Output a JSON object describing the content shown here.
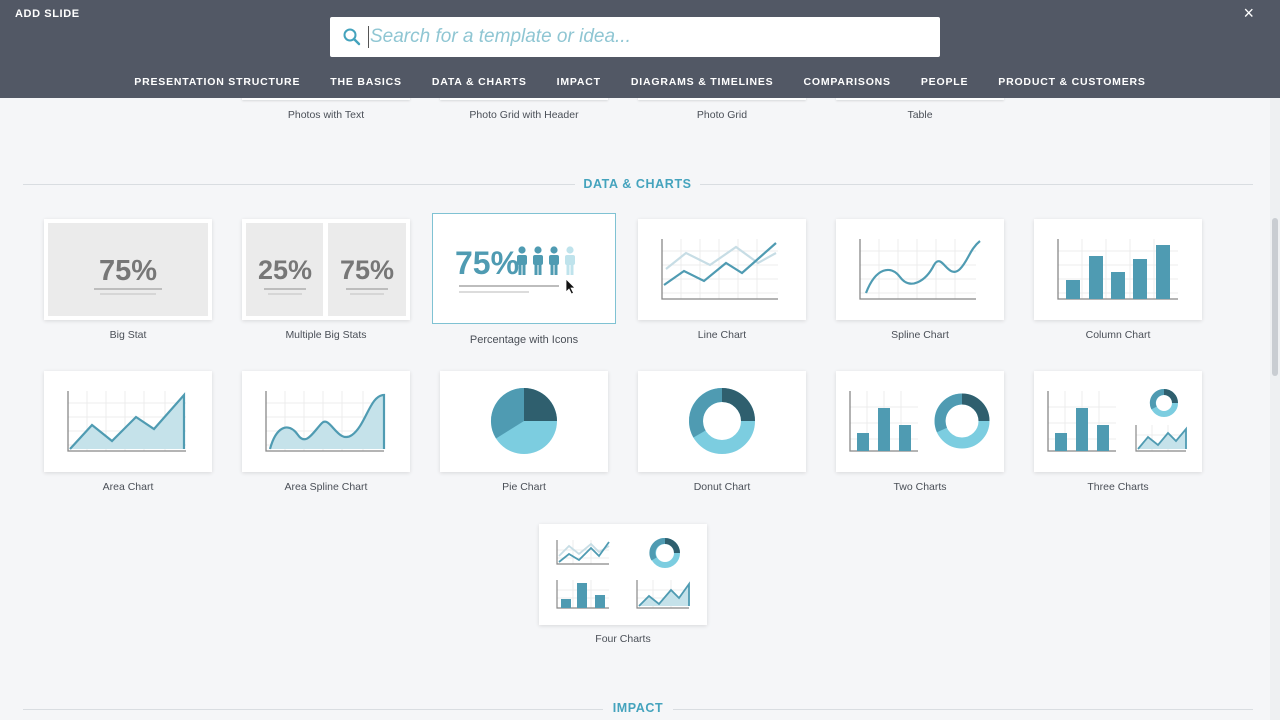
{
  "header": {
    "title": "ADD SLIDE",
    "close_label": "×"
  },
  "search": {
    "placeholder": "Search for a template or idea..."
  },
  "tabs": [
    "PRESENTATION STRUCTURE",
    "THE BASICS",
    "DATA & CHARTS",
    "IMPACT",
    "DIAGRAMS & TIMELINES",
    "COMPARISONS",
    "PEOPLE",
    "PRODUCT & CUSTOMERS"
  ],
  "top_row": [
    "Photos with Text",
    "Photo Grid with Header",
    "Photo Grid",
    "Table"
  ],
  "sections": {
    "data_charts": "DATA & CHARTS",
    "impact": "IMPACT"
  },
  "templates": {
    "big_stat": {
      "label": "Big Stat",
      "value": "75%"
    },
    "multiple_big_stats": {
      "label": "Multiple Big Stats",
      "value_a": "25%",
      "value_b": "75%"
    },
    "percentage_icons": {
      "label": "Percentage with Icons",
      "value": "75%"
    },
    "line_chart": {
      "label": "Line Chart"
    },
    "spline_chart": {
      "label": "Spline Chart"
    },
    "column_chart": {
      "label": "Column Chart"
    },
    "area_chart": {
      "label": "Area Chart"
    },
    "area_spline_chart": {
      "label": "Area Spline Chart"
    },
    "pie_chart": {
      "label": "Pie Chart"
    },
    "donut_chart": {
      "label": "Donut Chart"
    },
    "two_charts": {
      "label": "Two Charts"
    },
    "three_charts": {
      "label": "Three Charts"
    },
    "four_charts": {
      "label": "Four Charts"
    }
  },
  "colors": {
    "header_bg": "#525865",
    "accent": "#44a3bd",
    "chart_dark": "#2f5f6e",
    "chart_mid": "#4f9bb2",
    "chart_light": "#7ccde0",
    "stat_gray": "#777777"
  }
}
